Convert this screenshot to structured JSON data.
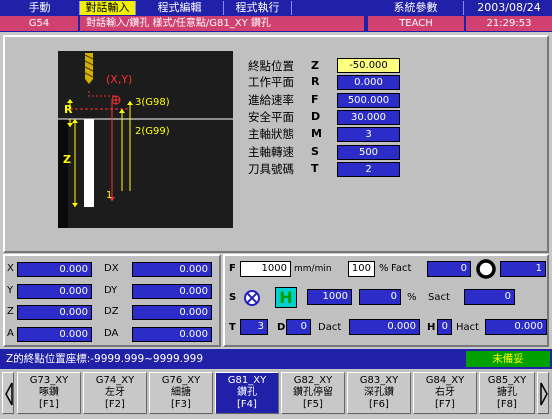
{
  "top_tabs": [
    {
      "label": "手動",
      "active": false
    },
    {
      "label": "對話輸入",
      "active": true
    },
    {
      "label": "程式編輯",
      "active": false
    },
    {
      "label": "程式執行",
      "active": false
    },
    {
      "label": "系統參數",
      "active": false
    },
    {
      "label": "2003/08/24",
      "active": false
    }
  ],
  "sub_row": {
    "gcode": "G54",
    "path": "對話輸入/鑽孔 樣式/任意點/G81_XY 鑽孔",
    "mode": "TEACH",
    "time": "21:29:53"
  },
  "diagram": {
    "xy": "(X,Y)",
    "r": "R",
    "g98": "3(G98)",
    "g99": "2(G99)",
    "z": "Z",
    "one": "1"
  },
  "params": [
    {
      "label": "終點位置",
      "code": "Z",
      "value": "-50.000",
      "style": "yellow"
    },
    {
      "label": "工作平面",
      "code": "R",
      "value": "0.000",
      "style": "blue"
    },
    {
      "label": "進給速率",
      "code": "F",
      "value": "500.000",
      "style": "blue"
    },
    {
      "label": "安全平面",
      "code": "D",
      "value": "30.000",
      "style": "blue"
    },
    {
      "label": "主軸狀態",
      "code": "M",
      "value": "3",
      "style": "blue"
    },
    {
      "label": "主軸轉速",
      "code": "S",
      "value": "500",
      "style": "blue"
    },
    {
      "label": "刀具號碼",
      "code": "T",
      "value": "2",
      "style": "blue"
    }
  ],
  "axes": [
    {
      "name": "X",
      "value": "0.000",
      "dname": "DX",
      "dvalue": "0.000"
    },
    {
      "name": "Y",
      "value": "0.000",
      "dname": "DY",
      "dvalue": "0.000"
    },
    {
      "name": "Z",
      "value": "0.000",
      "dname": "DZ",
      "dvalue": "0.000"
    },
    {
      "name": "A",
      "value": "0.000",
      "dname": "DA",
      "dvalue": "0.000"
    }
  ],
  "feed": {
    "label": "F",
    "value": "1000",
    "unit": "mm/min",
    "pct": "100",
    "pct_unit": "%",
    "fact_label": "Fact",
    "fact": "0",
    "one": "1"
  },
  "spindle": {
    "label": "S",
    "h": "H",
    "value": "1000",
    "pct": "0",
    "pct_unit": "%",
    "sact_label": "Sact",
    "sact": "0"
  },
  "tool": {
    "t_label": "T",
    "t": "3",
    "d_label": "D",
    "d": "0",
    "dact_label": "Dact",
    "dact": "0.000",
    "h_label": "H",
    "h": "0",
    "hact_label": "Hact",
    "hact": "0.000"
  },
  "status": {
    "message": "Z的終點位置座標:-9999.999~9999.999",
    "state": "未備妥"
  },
  "softkeys": [
    {
      "code": "G73_XY",
      "name": "啄鑽",
      "key": "[F1]",
      "active": false
    },
    {
      "code": "G74_XY",
      "name": "左牙",
      "key": "[F2]",
      "active": false
    },
    {
      "code": "G76_XY",
      "name": "細搪",
      "key": "[F3]",
      "active": false
    },
    {
      "code": "G81_XY",
      "name": "鑽孔",
      "key": "[F4]",
      "active": true
    },
    {
      "code": "G82_XY",
      "name": "鑽孔停留",
      "key": "[F5]",
      "active": false
    },
    {
      "code": "G83_XY",
      "name": "深孔鑽",
      "key": "[F6]",
      "active": false
    },
    {
      "code": "G84_XY",
      "name": "右牙",
      "key": "[F7]",
      "active": false
    },
    {
      "code": "G85_XY",
      "name": "搪孔",
      "key": "[F8]",
      "active": false
    }
  ]
}
